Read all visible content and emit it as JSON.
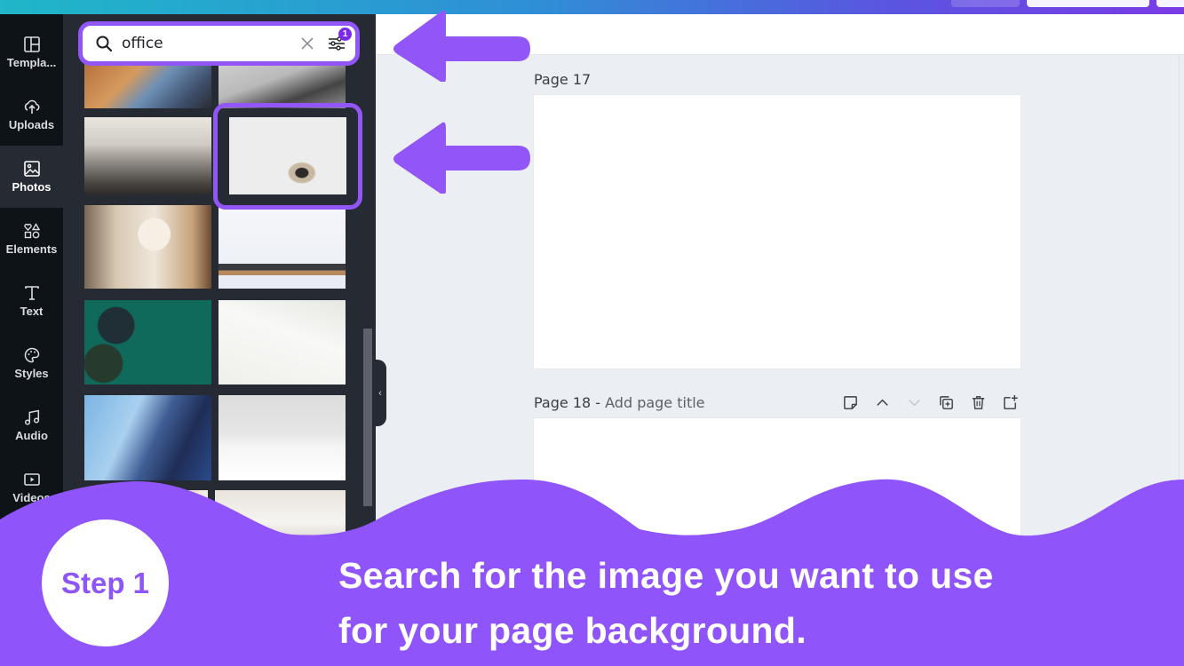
{
  "colors": {
    "accent": "#9255f8",
    "rail_bg": "#0e1318",
    "panel_bg": "#252a33",
    "canvas_bg": "#ebeef2",
    "badge": "#7d2ae8"
  },
  "rail": {
    "items": [
      {
        "label": "Templa...",
        "icon": "template-layout-icon"
      },
      {
        "label": "Uploads",
        "icon": "cloud-upload-icon"
      },
      {
        "label": "Photos",
        "icon": "image-icon",
        "active": true
      },
      {
        "label": "Elements",
        "icon": "shapes-icon"
      },
      {
        "label": "Text",
        "icon": "text-t-icon"
      },
      {
        "label": "Styles",
        "icon": "palette-icon"
      },
      {
        "label": "Audio",
        "icon": "music-note-icon"
      },
      {
        "label": "Videos",
        "icon": "video-play-icon"
      }
    ]
  },
  "search": {
    "value": "office",
    "filter_badge": "1"
  },
  "photos": [
    {
      "desc": "person typing on laptop at desk"
    },
    {
      "desc": "pen and phone on grey surface"
    },
    {
      "desc": "open plan office interior"
    },
    {
      "desc": "woman at white wall desk",
      "selected": true
    },
    {
      "desc": "smiling woman at laptop"
    },
    {
      "desc": "desk with lamp and laptop"
    },
    {
      "desc": "green desk flat lay with coffee"
    },
    {
      "desc": "notebook and pen on white"
    },
    {
      "desc": "glass skyscraper looking up"
    },
    {
      "desc": "plants and notebook on white desk"
    },
    {
      "desc": "office interior partial"
    },
    {
      "desc": "bright office interior partial"
    }
  ],
  "canvas": {
    "pages": [
      {
        "label": "Page 17",
        "subtitle": ""
      },
      {
        "label": "Page 18 - ",
        "subtitle": "Add page title"
      }
    ],
    "page_tools": [
      "notes-icon",
      "move-up-icon",
      "move-down-icon",
      "duplicate-page-icon",
      "delete-page-icon",
      "add-page-icon"
    ]
  },
  "banner": {
    "step": "Step 1",
    "caption_line1": "Search for the image you want to use",
    "caption_line2": "for your page background."
  }
}
